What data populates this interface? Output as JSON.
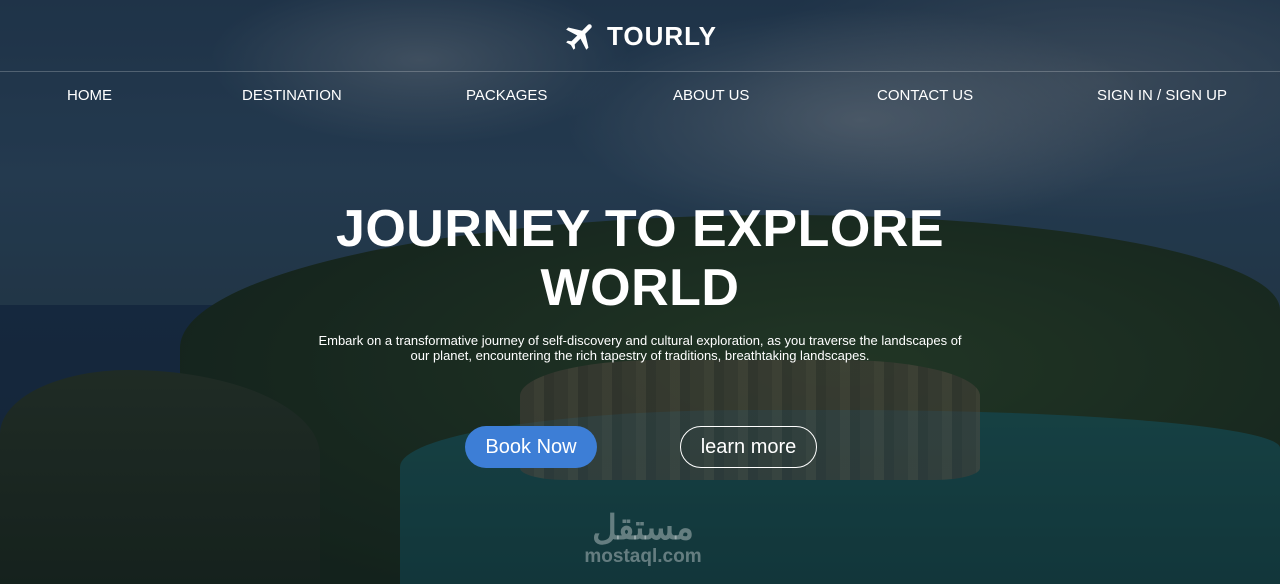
{
  "brand": {
    "name": "TOURLY",
    "icon": "airplane-icon"
  },
  "nav": {
    "home": "HOME",
    "destination": "DESTINATION",
    "packages": "PACKAGES",
    "about": "ABOUT US",
    "contact": "CONTACT US",
    "signin": "SIGN IN / SIGN UP"
  },
  "hero": {
    "title_line1": "JOURNEY TO EXPLORE",
    "title_line2": "WORLD",
    "description_line1": "Embark on a transformative journey of self-discovery and cultural exploration, as you traverse the landscapes of",
    "description_line2": "our planet, encountering the rich tapestry of traditions, breathtaking landscapes.",
    "book_label": "Book Now",
    "learn_label": "learn more"
  },
  "watermark": {
    "arabic": "مستقل",
    "latin": "mostaql.com"
  },
  "colors": {
    "accent": "#3d7ed6",
    "text": "#ffffff"
  }
}
